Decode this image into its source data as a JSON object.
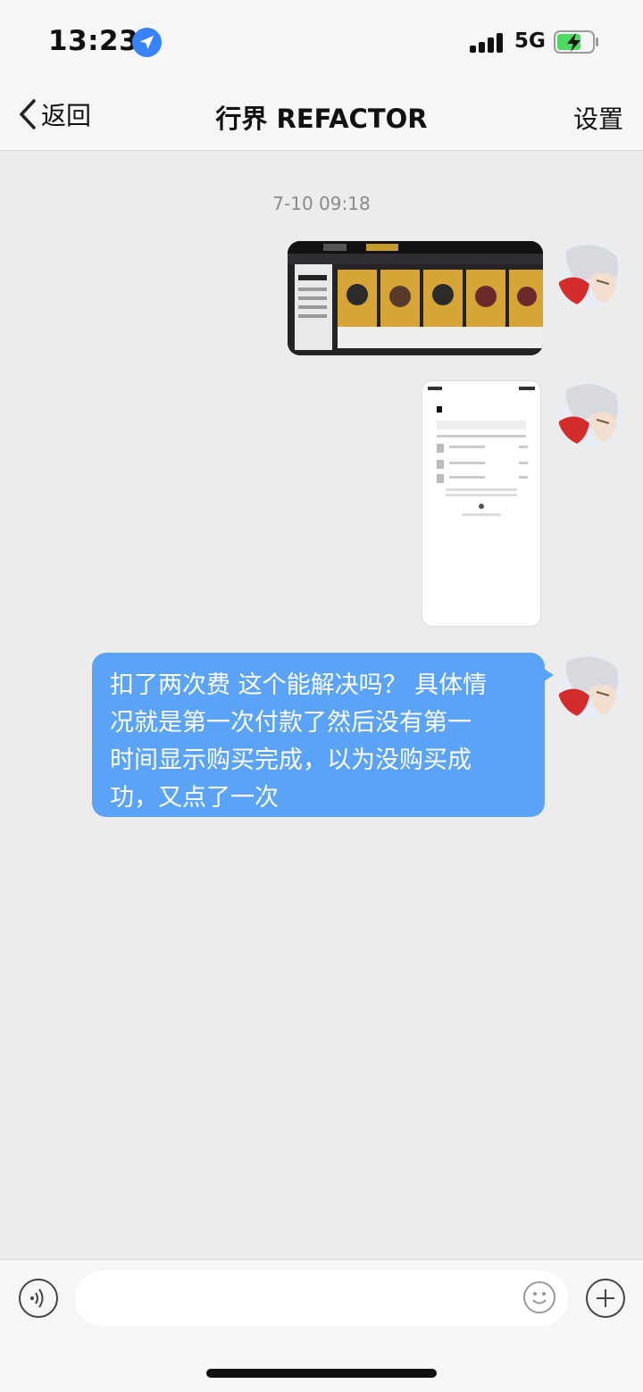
{
  "status_bar": {
    "time": "13:23",
    "network": "5G",
    "icons": [
      "location-arrow-icon",
      "signal-bars-icon",
      "battery-charging-icon"
    ],
    "colors": {
      "location": "#3a82f7",
      "battery": "#4cd964"
    }
  },
  "nav": {
    "back_label": "返回",
    "title": "行界 REFACTOR",
    "settings_label": "设置"
  },
  "chat": {
    "timestamp": "7-10 09:18",
    "messages": [
      {
        "type": "image",
        "sender": "me",
        "content": "game store screenshot"
      },
      {
        "type": "image",
        "sender": "me",
        "content": "purchase receipt screenshot"
      },
      {
        "type": "text",
        "sender": "me",
        "lines": [
          "扣了两次费 这个能解决吗？ 具体情",
          "况就是第一次付款了然后没有第一",
          "时间显示购买完成，以为没购买成",
          "功，又点了一次"
        ]
      }
    ],
    "bubble_color": "#5ba3f6"
  },
  "input_bar": {
    "placeholder": "",
    "icons": [
      "voice-icon",
      "emoji-icon",
      "plus-icon"
    ]
  }
}
